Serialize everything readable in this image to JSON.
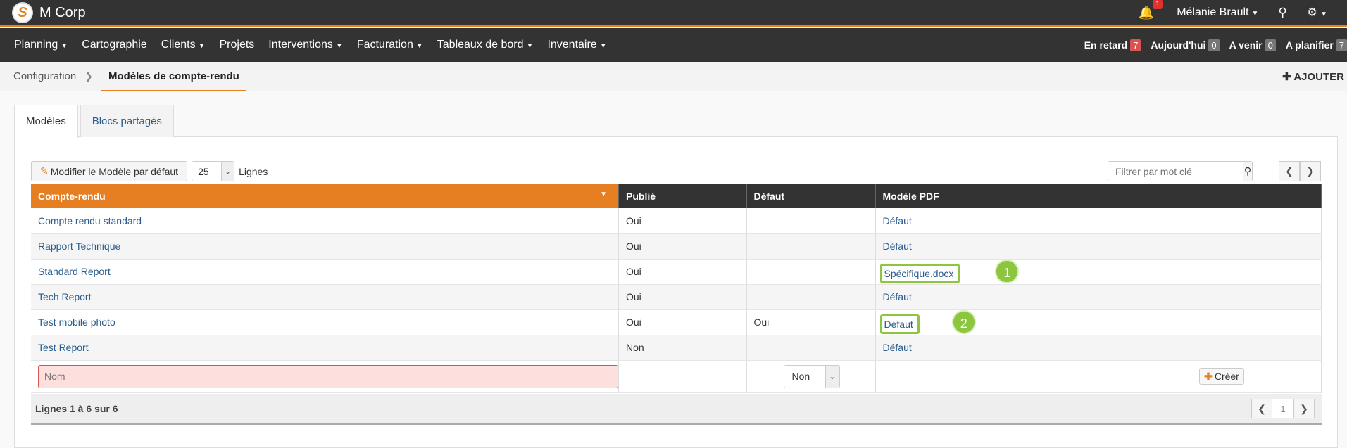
{
  "app": {
    "logo_letter": "S",
    "name": "M Corp"
  },
  "topbar": {
    "notifications_count": "1",
    "user_name": "Mélanie Brault",
    "search_icon": "search-icon",
    "settings_icon": "gear-icon"
  },
  "nav": {
    "items": [
      "Planning",
      "Cartographie",
      "Clients",
      "Projets",
      "Interventions",
      "Facturation",
      "Tableaux de bord",
      "Inventaire"
    ],
    "counters": [
      {
        "label": "En retard",
        "count": "7",
        "color": "#d9534f"
      },
      {
        "label": "Aujourd'hui",
        "count": "0",
        "color": "#777777"
      },
      {
        "label": "A venir",
        "count": "0",
        "color": "#777777"
      },
      {
        "label": "A planifier",
        "count": "7",
        "color": "#777777"
      }
    ]
  },
  "breadcrumb": {
    "parent": "Configuration",
    "current": "Modèles de compte-rendu",
    "add_label": "AJOUTER"
  },
  "tabs": [
    "Modèles",
    "Blocs partagés"
  ],
  "toolbar": {
    "edit_default_label": "Modifier le Modèle par défaut",
    "page_size": "25",
    "lines_label": "Lignes",
    "filter_placeholder": "Filtrer par mot clé"
  },
  "table": {
    "headers": [
      "Compte-rendu",
      "Publié",
      "Défaut",
      "Modèle PDF",
      ""
    ],
    "rows": [
      {
        "name": "Compte rendu standard",
        "published": "Oui",
        "default": "",
        "pdf": "Défaut"
      },
      {
        "name": "Rapport Technique",
        "published": "Oui",
        "default": "",
        "pdf": "Défaut"
      },
      {
        "name": "Standard Report",
        "published": "Oui",
        "default": "",
        "pdf": "Spécifique.docx"
      },
      {
        "name": "Tech Report",
        "published": "Oui",
        "default": "",
        "pdf": "Défaut"
      },
      {
        "name": "Test mobile photo",
        "published": "Oui",
        "default": "Oui",
        "pdf": "Défaut"
      },
      {
        "name": "Test Report",
        "published": "Non",
        "default": "",
        "pdf": "Défaut"
      }
    ],
    "new_row": {
      "name_placeholder": "Nom",
      "default_value": "Non",
      "create_label": "Créer"
    }
  },
  "markers": [
    "1",
    "2"
  ],
  "footer": {
    "summary": "Lignes 1 à 6 sur 6",
    "page": "1"
  },
  "colors": {
    "accent": "#e67e22",
    "highlight": "#8cc63f",
    "link": "#2a5d8f"
  }
}
